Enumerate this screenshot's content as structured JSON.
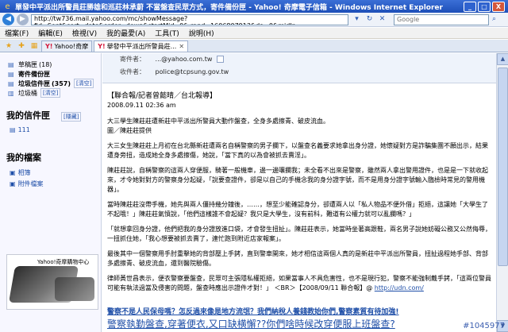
{
  "window": {
    "title": "單發中平派出所警員莊勝雄和巡莊林承蔚 不當盤查民眾方式，寄件備份匣 - Yahoo! 奇摩電子信箱 - Windows Internet Explorer",
    "buttons": [
      "_",
      "□",
      "X"
    ]
  },
  "address": {
    "url": "http://tw736.mail.yahoo.com/mc/showMessage?fid=Sent&sort=date&order=down&startMid=0&.rand=1606807913&da=0&midIn",
    "search_placeholder": "Google"
  },
  "menu": [
    "檔案(F)",
    "編輯(E)",
    "檢視(V)",
    "我的最愛(A)",
    "工具(T)",
    "說明(H)"
  ],
  "tabs": [
    {
      "label": "Yahoo!奇摩",
      "active": false
    },
    {
      "label": "舉發中平派出所警員莊...",
      "active": true
    }
  ],
  "sidebar": {
    "folders": [
      {
        "label": "草稿匣",
        "count": "(18)",
        "bold": false,
        "clear": ""
      },
      {
        "label": "寄件備份匣",
        "count": "",
        "bold": true,
        "clear": ""
      },
      {
        "label": "垃圾信件匣",
        "count": "(357)",
        "bold": true,
        "clear": "[清空]"
      },
      {
        "label": "垃圾桶",
        "count": "",
        "bold": false,
        "clear": "[清空]"
      }
    ],
    "my_folders_title": "我的信件匣",
    "my_folders_hide": "[隱藏]",
    "my_folders_items": [
      "111"
    ],
    "my_files_title": "我的檔案",
    "my_files_items": [
      "相簿",
      "附件檔案"
    ],
    "ad_title": "Yahoo!奇摩購物中心"
  },
  "message": {
    "from_label": "寄件者：",
    "from_value": "...@yahoo.com.tw",
    "to_label": "收件者：",
    "to_value": "police@tcpsung.gov.tw",
    "source": "【聯合報/記者曾懿晴／台北報導】",
    "date": "2008.09.11 02:36 am",
    "paragraphs": [
      "大三學生陳莊莊遭新莊中平派出所警員大動作盤查，全身多處擦青、破皮流血。",
      "圖／陳莊莊提供",
      "大三女生陳莊莊上月初在台北縣新莊遭兩名自稱警察的男子攔下，以盤查名義要求她拿出身分證，她懷疑對方是詐騙集團不願出示，結果遭身旁扭，造成她全身多處擦傷，她說，「當下真的以為會被抓去賣淫」。",
      "陳莊莊說，自稱警察的這兩人穿便服，騎著一般機車，邊一邊嚷攔我；未全看不出來是警察，雖然兩人拿出警用證件，也是是一下就收起來，才令她對對方的警察身分起疑，「說要查證件，卻是以自己的手機念我的身分證字號，而不是用身分證字號輸入臨檢時常見的警用機器」。",
      "當時陳莊莊沒帶手機，她先與兩人僵持幾分鐘後，……，想至少能確認身分，卻遭兩人以「私人物品不便外借」拒絕，這讓她「大學生了不起哦！」陳莊莊氣憤說，「他們這樣誰不會起疑？我只是大學生，沒有前科，難道有公權力就可以亂攔嗎？」",
      "「就想拿回身分證，他們把我的身分證放進口袋，才會發生扭扯」。陳莊莊表示，她當時坐著高跟鞋，兩名男子說她妨礙公務又公然侮辱，一扭抓住她，「我心想要被抓去賣了，連忙跑到附近店家報案」。",
      "最後其中一個警察用手肘重擊她的背部壓上手銬，直到警車開來，她才相信這兩個人真的是新莊中平派出所警員，扭扯過程她手部、背部多處擦青、破皮流血，還到醫院驗傷。",
      "律師黃世昌表示，便衣警察要盤查，民眾可主張隱私權拒絕，如果當事人不具危害性，也不是現行犯，警察不能強制戴手銬，「這兩位警員可能有執法過當及侵害的問題，盤查時應出示證件才對！」"
    ],
    "source_tail": "＜BR＞【2008/09/11 聯合報】@",
    "source_link": "http://udn.com/",
    "footer_link1": "警察不是人民保母嗎？怎反過來像是地方流氓？我們納稅人養錢教始你們,警察素質有待加強!",
    "footer_link2": "警察執勤盤查,穿著便衣,又口缺横懈??你們啥時候改穿便服上班盤查?"
  },
  "watermark": "#1045977"
}
